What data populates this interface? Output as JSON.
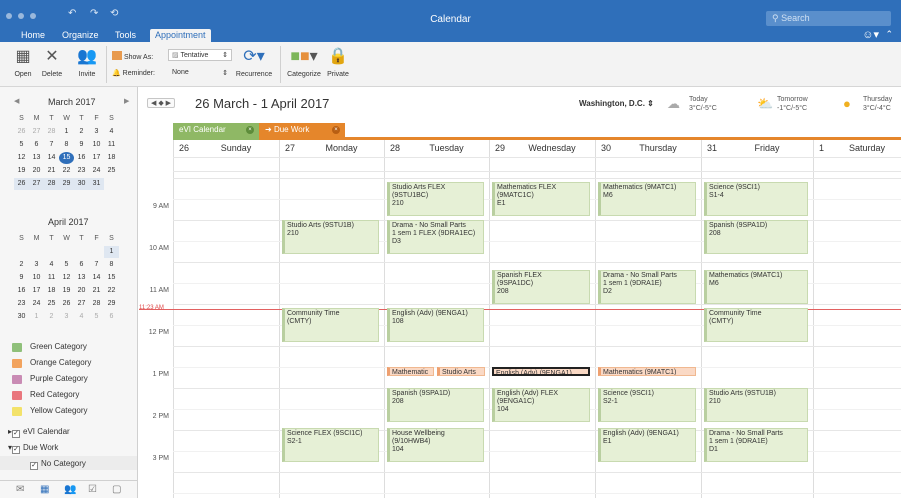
{
  "window": {
    "title": "Calendar",
    "search_placeholder": "Search"
  },
  "tabs": [
    "Home",
    "Organize",
    "Tools",
    "Appointment"
  ],
  "ribbon": {
    "open": "Open",
    "delete": "Delete",
    "invite": "Invite",
    "show_as_label": "Show As:",
    "show_as_value": "Tentative",
    "reminder_label": "Reminder:",
    "reminder_value": "None",
    "recurrence": "Recurrence",
    "categorize": "Categorize",
    "private": "Private"
  },
  "mini_march": {
    "title": "March 2017",
    "dow": [
      "S",
      "M",
      "T",
      "W",
      "T",
      "F",
      "S"
    ],
    "days": [
      [
        "26",
        "m"
      ],
      [
        "27",
        "m"
      ],
      [
        "28",
        "m"
      ],
      [
        "1",
        "d"
      ],
      [
        "2",
        "d"
      ],
      [
        "3",
        "d"
      ],
      [
        "4",
        "d"
      ],
      [
        "5",
        "d"
      ],
      [
        "6",
        "d"
      ],
      [
        "7",
        "d"
      ],
      [
        "8",
        "d"
      ],
      [
        "9",
        "d"
      ],
      [
        "10",
        "d"
      ],
      [
        "11",
        "d"
      ],
      [
        "12",
        "d"
      ],
      [
        "13",
        "d"
      ],
      [
        "14",
        "d"
      ],
      [
        "15",
        "t"
      ],
      [
        "16",
        "d"
      ],
      [
        "17",
        "d"
      ],
      [
        "18",
        "d"
      ],
      [
        "19",
        "d"
      ],
      [
        "20",
        "d"
      ],
      [
        "21",
        "d"
      ],
      [
        "22",
        "d"
      ],
      [
        "23",
        "d"
      ],
      [
        "24",
        "d"
      ],
      [
        "25",
        "d"
      ],
      [
        "26",
        "s"
      ],
      [
        "27",
        "s"
      ],
      [
        "28",
        "s"
      ],
      [
        "29",
        "s"
      ],
      [
        "30",
        "s"
      ],
      [
        "31",
        "s"
      ]
    ]
  },
  "mini_april": {
    "title": "April 2017",
    "dow": [
      "S",
      "M",
      "T",
      "W",
      "T",
      "F",
      "S"
    ],
    "days": [
      [
        "",
        "b"
      ],
      [
        "",
        "b"
      ],
      [
        "",
        "b"
      ],
      [
        "",
        "b"
      ],
      [
        "",
        "b"
      ],
      [
        "",
        "b"
      ],
      [
        "1",
        "s"
      ],
      [
        "2",
        "d"
      ],
      [
        "3",
        "d"
      ],
      [
        "4",
        "d"
      ],
      [
        "5",
        "d"
      ],
      [
        "6",
        "d"
      ],
      [
        "7",
        "d"
      ],
      [
        "8",
        "d"
      ],
      [
        "9",
        "d"
      ],
      [
        "10",
        "d"
      ],
      [
        "11",
        "d"
      ],
      [
        "12",
        "d"
      ],
      [
        "13",
        "d"
      ],
      [
        "14",
        "d"
      ],
      [
        "15",
        "d"
      ],
      [
        "16",
        "d"
      ],
      [
        "17",
        "d"
      ],
      [
        "18",
        "d"
      ],
      [
        "19",
        "d"
      ],
      [
        "20",
        "d"
      ],
      [
        "21",
        "d"
      ],
      [
        "22",
        "d"
      ],
      [
        "23",
        "d"
      ],
      [
        "24",
        "d"
      ],
      [
        "25",
        "d"
      ],
      [
        "26",
        "d"
      ],
      [
        "27",
        "d"
      ],
      [
        "28",
        "d"
      ],
      [
        "29",
        "d"
      ],
      [
        "30",
        "d"
      ],
      [
        "1",
        "m"
      ],
      [
        "2",
        "m"
      ],
      [
        "3",
        "m"
      ],
      [
        "4",
        "m"
      ],
      [
        "5",
        "m"
      ],
      [
        "6",
        "m"
      ]
    ]
  },
  "categories": [
    {
      "label": "Green Category",
      "color": "#8fc07a"
    },
    {
      "label": "Orange Category",
      "color": "#f2a35e"
    },
    {
      "label": "Purple Category",
      "color": "#c98bb4"
    },
    {
      "label": "Red Category",
      "color": "#e9767d"
    },
    {
      "label": "Yellow Category",
      "color": "#f3e26a"
    }
  ],
  "tree": {
    "evi_calendar": "eVI Calendar",
    "due_work": "Due Work",
    "no_category": "No Category"
  },
  "header": {
    "date_range": "26 March - 1 April 2017",
    "location": "Washington, D.C.",
    "weather": [
      {
        "day": "Today",
        "temp": "3°C/-5°C"
      },
      {
        "day": "Tomorrow",
        "temp": "-1°C/-5°C"
      },
      {
        "day": "Thursday",
        "temp": "3°C/-4°C"
      }
    ]
  },
  "cal_tabs": [
    {
      "label": "eVI Calendar",
      "color": "#8fb865"
    },
    {
      "label": "Due Work",
      "color": "#e5862b"
    }
  ],
  "days": [
    {
      "num": "26",
      "name": "Sunday"
    },
    {
      "num": "27",
      "name": "Monday"
    },
    {
      "num": "28",
      "name": "Tuesday"
    },
    {
      "num": "29",
      "name": "Wednesday"
    },
    {
      "num": "30",
      "name": "Thursday"
    },
    {
      "num": "31",
      "name": "Friday"
    },
    {
      "num": "1",
      "name": "Saturday"
    }
  ],
  "times": [
    "9 AM",
    "10 AM",
    "11 AM",
    "12 PM",
    "1 PM",
    "2 PM",
    "3 PM"
  ],
  "now_label": "11:23 AM",
  "events": [
    {
      "day": 2,
      "start": 8.6,
      "end": 9.4,
      "lines": [
        "Studio Arts FLEX",
        "(9STU1BC)",
        "210"
      ]
    },
    {
      "day": 3,
      "start": 8.6,
      "end": 9.4,
      "lines": [
        "Mathematics FLEX",
        "(9MATC1C)",
        "E1"
      ]
    },
    {
      "day": 4,
      "start": 8.6,
      "end": 9.4,
      "lines": [
        "Mathematics (9MATC1)",
        "M6"
      ]
    },
    {
      "day": 5,
      "start": 8.6,
      "end": 9.4,
      "lines": [
        "Science (9SCI1)",
        "S1-4"
      ]
    },
    {
      "day": 1,
      "start": 9.5,
      "end": 10.3,
      "lines": [
        "Studio Arts (9STU1B)",
        "210"
      ]
    },
    {
      "day": 2,
      "start": 9.5,
      "end": 10.3,
      "lines": [
        "Drama - No Small Parts",
        "1 sem 1 FLEX (9DRA1EC)",
        "D3"
      ]
    },
    {
      "day": 5,
      "start": 9.5,
      "end": 10.3,
      "lines": [
        "Spanish (9SPA1D)",
        "208"
      ]
    },
    {
      "day": 3,
      "start": 10.7,
      "end": 11.5,
      "lines": [
        "Spanish FLEX",
        "(9SPA1DC)",
        "208"
      ]
    },
    {
      "day": 4,
      "start": 10.7,
      "end": 11.5,
      "lines": [
        "Drama - No Small Parts",
        "1 sem 1 (9DRA1E)",
        "D2"
      ]
    },
    {
      "day": 5,
      "start": 10.7,
      "end": 11.5,
      "lines": [
        "Mathematics (9MATC1)",
        "M6"
      ]
    },
    {
      "day": 1,
      "start": 11.6,
      "end": 12.4,
      "lines": [
        "Community Time",
        "(CMTY)"
      ]
    },
    {
      "day": 2,
      "start": 11.6,
      "end": 12.4,
      "lines": [
        "English (Adv) (9ENGA1)",
        "108"
      ]
    },
    {
      "day": 5,
      "start": 11.6,
      "end": 12.4,
      "lines": [
        "Community Time",
        "(CMTY)"
      ]
    },
    {
      "day": 2,
      "start": 13.0,
      "end": 13.22,
      "orange": true,
      "half": "left",
      "lines": [
        "Mathematic"
      ]
    },
    {
      "day": 2,
      "start": 13.0,
      "end": 13.22,
      "orange": true,
      "half": "right",
      "lines": [
        "Studio Arts"
      ]
    },
    {
      "day": 3,
      "start": 13.0,
      "end": 13.22,
      "orange": true,
      "selected": true,
      "lines": [
        "English (Adv) (9ENGA1)"
      ]
    },
    {
      "day": 4,
      "start": 13.0,
      "end": 13.22,
      "orange": true,
      "lines": [
        "Mathematics (9MATC1)"
      ]
    },
    {
      "day": 2,
      "start": 13.5,
      "end": 14.3,
      "lines": [
        "Spanish (9SPA1D)",
        "208"
      ]
    },
    {
      "day": 3,
      "start": 13.5,
      "end": 14.3,
      "lines": [
        "English (Adv) FLEX",
        "(9ENGA1C)",
        "104"
      ]
    },
    {
      "day": 4,
      "start": 13.5,
      "end": 14.3,
      "lines": [
        "Science (9SCI1)",
        "S2-1"
      ]
    },
    {
      "day": 5,
      "start": 13.5,
      "end": 14.3,
      "lines": [
        "Studio Arts (9STU1B)",
        "210"
      ]
    },
    {
      "day": 1,
      "start": 14.45,
      "end": 15.25,
      "lines": [
        "Science FLEX (9SCI1C)",
        "S2-1"
      ]
    },
    {
      "day": 2,
      "start": 14.45,
      "end": 15.25,
      "lines": [
        "House Wellbeing",
        "(9/10HWB4)",
        "104"
      ]
    },
    {
      "day": 4,
      "start": 14.45,
      "end": 15.25,
      "lines": [
        "English (Adv) (9ENGA1)",
        "E1"
      ]
    },
    {
      "day": 5,
      "start": 14.45,
      "end": 15.25,
      "lines": [
        "Drama - No Small Parts",
        "1 sem 1 (9DRA1E)",
        "D1"
      ]
    }
  ]
}
